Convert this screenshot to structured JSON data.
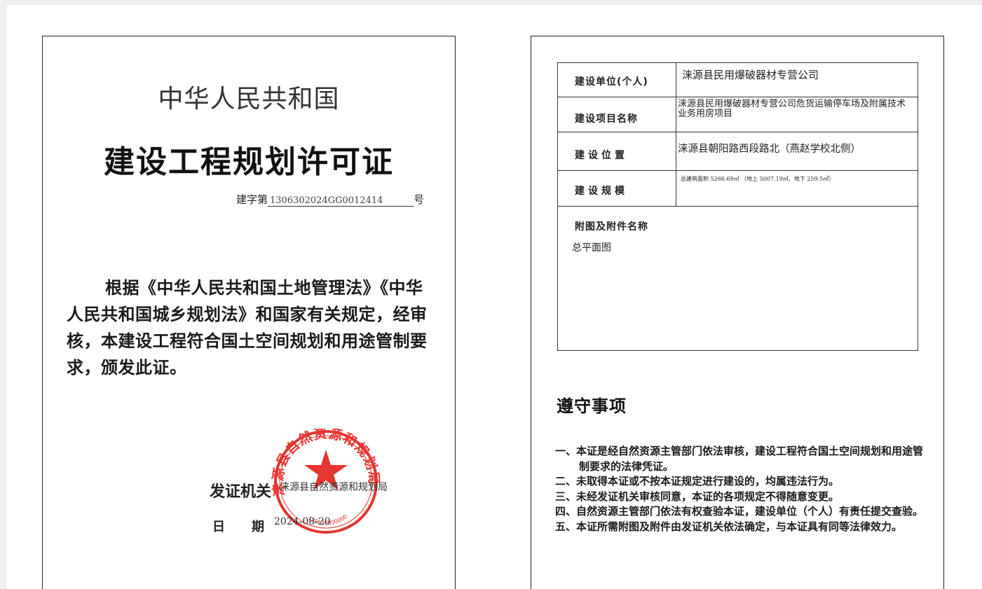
{
  "left_page": {
    "country": "中华人民共和国",
    "title": "建设工程规划许可证",
    "cert_number_prefix": "建字第",
    "cert_number": "1306302024GG0012414",
    "cert_number_suffix": "号",
    "body_text": "根据《中华人民共和国土地管理法》《中华人民共和国城乡规划法》和国家有关规定，经审核，本建设工程符合国土空间规划和用途管制要求，颁发此证。",
    "issuer_label": "发证机关",
    "issuer": "涞源县自然资源和规划局",
    "date_label": "日期",
    "date": "2024-08-20",
    "seal": {
      "text": "涞源县自然资源和规划局",
      "serial": "1306300000000",
      "color": "#e32520"
    }
  },
  "right_page": {
    "rows": [
      {
        "label": "建设单位(个人)",
        "value": "涞源县民用爆破器材专营公司"
      },
      {
        "label": "建设项目名称",
        "value": "涞源县民用爆破器材专营公司危货运输停车场及附属技术业务用房项目"
      },
      {
        "label": "建设位置",
        "value": "涞源县朝阳路西段路北（燕赵学校北侧）"
      },
      {
        "label": "建设规模",
        "value": "总建筑面积 5266.69㎡ （地上 5007.19㎡、地下 259.5㎡）"
      }
    ],
    "attachments_label": "附图及附件名称",
    "attachments_value": "总平面图",
    "notes_title": "遵守事项",
    "notes": [
      "一、本证是经自然资源主管部门依法审核，建设工程符合国土空间规划和用途管制要求的法律凭证。",
      "二、未取得本证或不按本证规定进行建设的，均属违法行为。",
      "三、未经发证机关审核同意，本证的各项规定不得随意变更。",
      "四、自然资源主管部门依法有权查验本证，建设单位（个人）有责任提交查验。",
      "五、本证所需附图及附件由发证机关依法确定，与本证具有同等法律效力。"
    ]
  }
}
